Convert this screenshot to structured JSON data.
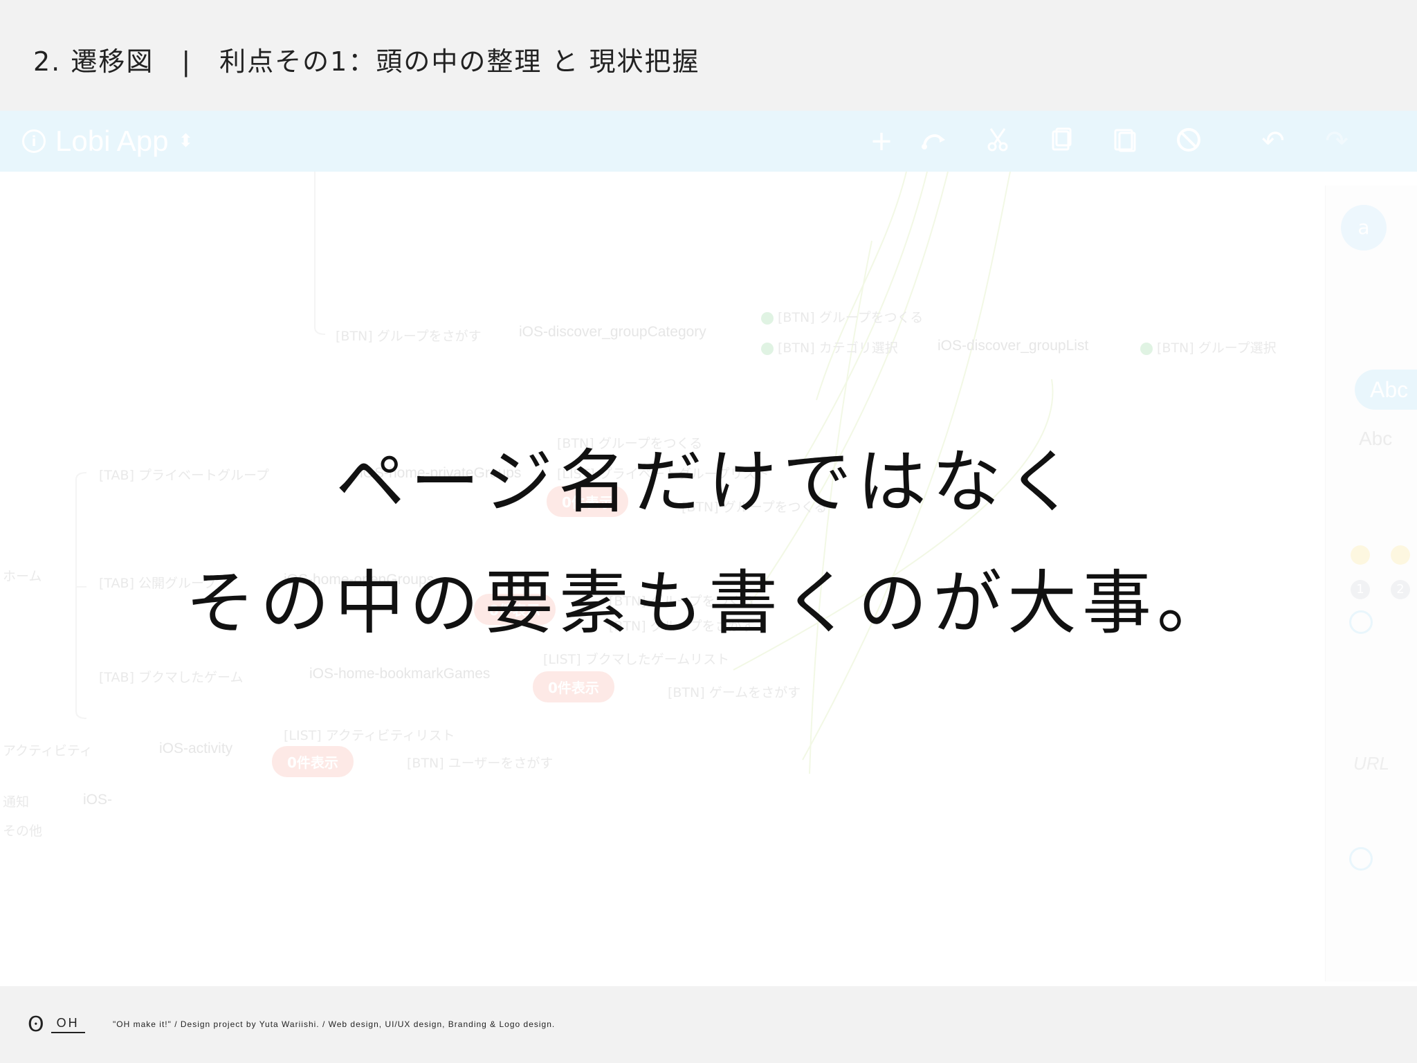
{
  "header": {
    "title": "2. 遷移図　|　利点その1：頭の中の整理 と 現状把握"
  },
  "app": {
    "title": "Lobi App",
    "switch_glyph": "⬍",
    "toolbar": {
      "add_glyph": "+",
      "undo_glyph": "↶",
      "redo_glyph": "↷"
    }
  },
  "map": {
    "rows": {
      "home": "ホーム",
      "activity": "アクティビティ",
      "notification": "通知",
      "other": "その他"
    },
    "tabs": {
      "private_group": "[TAB] プライベートグループ",
      "public_group": "[TAB] 公開グループ",
      "bookmark_games": "[TAB] ブクマしたゲーム"
    },
    "pages": {
      "discover_group_category": "iOS-discover_groupCategory",
      "discover_group_list": "iOS-discover_groupList",
      "home_open_groups": "iOS-home-openGroups",
      "home_private_groups": "iOS-home-privateGroups",
      "home_bookmark_games": "iOS-home-bookmarkGames",
      "activity": "iOS-activity",
      "notification": "iOS-"
    },
    "actions": {
      "search_group_top": "[BTN] グループをさがす",
      "create_group_top": "[BTN] グループをつくる",
      "category_select": "[BTN] カテゴリ選択",
      "group_select": "[BTN] グループ選択",
      "create_group_private_1": "[BTN] グループをつくる",
      "private_group_list": "[LIST] プライベートグループリスト",
      "create_group_private_2": "[BTN] グループをつくる",
      "create_group_public": "[BTN] グループをつくる",
      "search_group_public": "[BTN] グループをさがす",
      "bookmark_game_list": "[LIST] ブクマしたゲームリスト",
      "search_game": "[BTN] ゲームをさがす",
      "activity_list": "[LIST] アクティビティリスト",
      "search_user": "[BTN] ユーザーをさがす"
    },
    "badges": {
      "zero_items": "0件表示"
    }
  },
  "side_panel": {
    "avatar_letter": "a",
    "abc_pill": "Abc",
    "abc_plain": "Abc",
    "num_1": "1",
    "num_2": "2",
    "url_label": "URL"
  },
  "headline": {
    "line1": "ページ名だけではなく",
    "line2": "その中の要素も書くのが大事。"
  },
  "footer": {
    "logo_text": "OH",
    "credit": "\"OH make it!\"  /  Design project by Yuta Wariishi.  /  Web design, UI/UX design, Branding & Logo design."
  },
  "colors": {
    "toolbar": "#d6effa",
    "badge": "#fbd8d2",
    "connector": "#e6f3c8",
    "header_bg": "#f2f2f2"
  }
}
